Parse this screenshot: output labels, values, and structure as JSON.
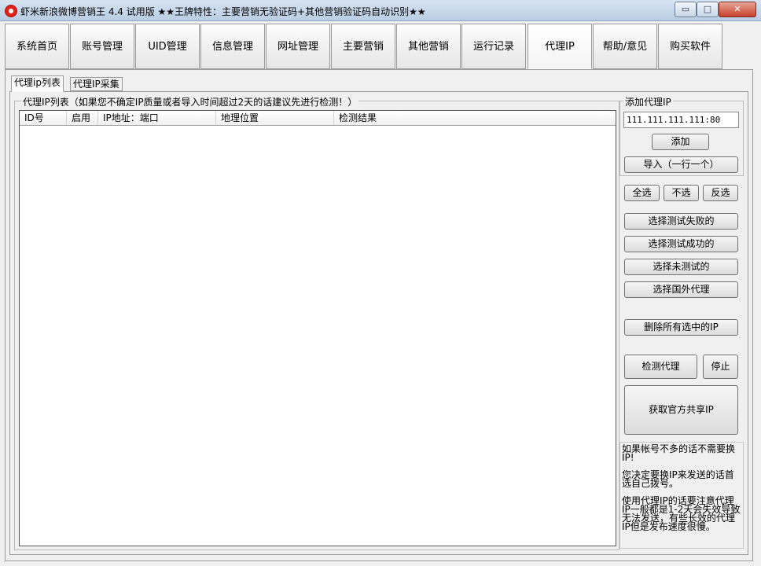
{
  "window": {
    "title": "虾米新浪微博营销王 4.4 试用版   ★★王牌特性：主要营销无验证码+其他营销验证码自动识别★★",
    "minimize": "▭",
    "maximize": "□",
    "close": "✕"
  },
  "nav": {
    "tabs": [
      "系统首页",
      "账号管理",
      "UID管理",
      "信息管理",
      "网址管理",
      "主要营销",
      "其他营销",
      "运行记录",
      "代理IP",
      "帮助/意见",
      "购买软件"
    ],
    "active_index": 8
  },
  "subtabs": [
    "代理ip列表",
    "代理IP采集"
  ],
  "list": {
    "group_label": "代理IP列表（如果您不确定IP质量或者导入时间超过2天的话建议先进行检测！）",
    "columns": [
      "ID号",
      "启用",
      "IP地址：端口",
      "地理位置",
      "检测结果"
    ]
  },
  "add_proxy": {
    "group_label": "添加代理IP",
    "input_value": "111.111.111.111:80",
    "add_label": "添加",
    "import_label": "导入（一行一个）"
  },
  "select": {
    "all": "全选",
    "none": "不选",
    "invert": "反选",
    "failed": "选择测试失败的",
    "succeeded": "选择测试成功的",
    "untested": "选择未测试的",
    "foreign": "选择国外代理"
  },
  "actions": {
    "delete_selected": "删除所有选中的IP",
    "check_proxy": "检测代理",
    "stop": "停止",
    "get_official": "获取官方共享IP"
  },
  "tips": [
    "如果帐号不多的话不需要换IP!",
    "您决定要换IP来发送的话首选自己拨号。",
    "使用代理IP的话要注意代理IP一般都是1-2天会失效导致无法发送，有些长效的代理IP但是发布速度很慢。"
  ]
}
